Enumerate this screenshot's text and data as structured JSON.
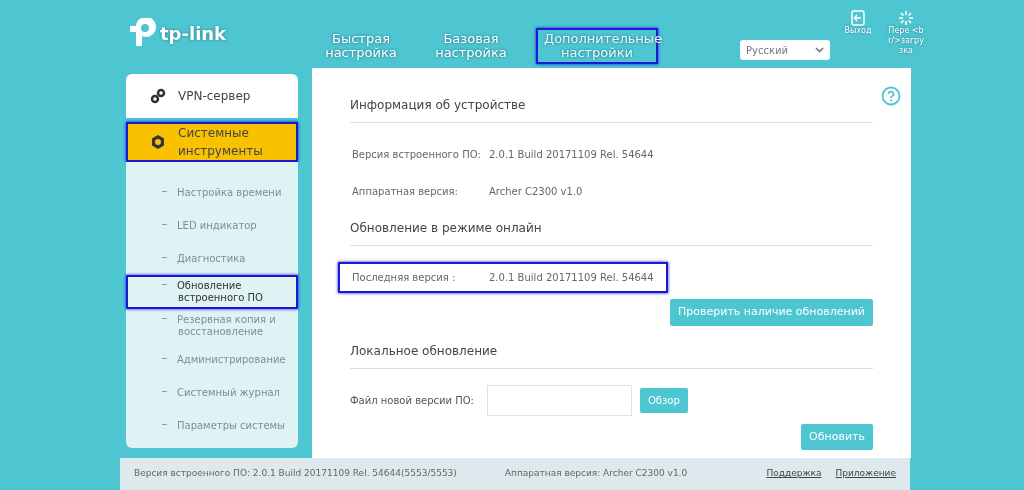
{
  "logo": {
    "text": "tp-link"
  },
  "nav_tabs": [
    {
      "label": "Быстрая настройка",
      "selected": false,
      "highlighted": false
    },
    {
      "label": "Базовая настройка",
      "selected": false,
      "highlighted": false
    },
    {
      "label": "Дополнительные настройки",
      "selected": true,
      "highlighted": true
    }
  ],
  "language_select": {
    "value": "Русский"
  },
  "header_actions": [
    {
      "kind": "logout",
      "label": "Выход"
    },
    {
      "kind": "reboot",
      "label": "Пере <br/>загрузка"
    }
  ],
  "sidebar": {
    "items": [
      {
        "kind": "vpn",
        "label": "VPN-сервер",
        "selected": false,
        "highlighted": false
      },
      {
        "kind": "tools",
        "label": "Системные инструменты",
        "selected": true,
        "highlighted": true,
        "expanded": true,
        "children": [
          {
            "label": "Настройка времени",
            "selected": false,
            "highlighted": false
          },
          {
            "label": "LED индикатор",
            "selected": false,
            "highlighted": false
          },
          {
            "label": "Диагностика",
            "selected": false,
            "highlighted": false
          },
          {
            "label": "Обновление встроенного ПО",
            "selected": true,
            "highlighted": true
          },
          {
            "label": "Резервная копия и восстановление",
            "selected": false,
            "highlighted": false
          },
          {
            "label": "Администрирование",
            "selected": false,
            "highlighted": false
          },
          {
            "label": "Системный журнал",
            "selected": false,
            "highlighted": false
          },
          {
            "label": "Параметры системы",
            "selected": false,
            "highlighted": false
          }
        ]
      }
    ]
  },
  "sections": [
    {
      "title": "Информация об устройстве",
      "items": [
        {
          "kind": "row",
          "label": "Версия встроенного ПО:",
          "value": "2.0.1 Build 20171109 Rel. 54644",
          "highlighted": false
        },
        {
          "kind": "row",
          "label": "Аппаратная версия:",
          "value": "Archer C2300 v1.0",
          "highlighted": false
        }
      ]
    },
    {
      "title": "Обновление в режиме онлайн",
      "items": [
        {
          "kind": "row",
          "label": "Последняя версия :",
          "value": "2.0.1 Build 20171109 Rel. 54644",
          "highlighted": true
        },
        {
          "kind": "button",
          "label": "Проверить наличие обновлений"
        }
      ]
    },
    {
      "title": "Локальное обновление",
      "items": [
        {
          "kind": "file",
          "label": "Файл новой версии ПО:",
          "button": "Обзор"
        },
        {
          "kind": "button",
          "label": "Обновить"
        }
      ]
    }
  ],
  "footer": {
    "firmware": "Версия встроенного ПО: 2.0.1 Build 20171109 Rel. 54644(5553/5553)",
    "hardware": "Аппаратная версия: Archer C2300 v1.0",
    "links": [
      "Поддержка",
      "Приложение"
    ]
  }
}
